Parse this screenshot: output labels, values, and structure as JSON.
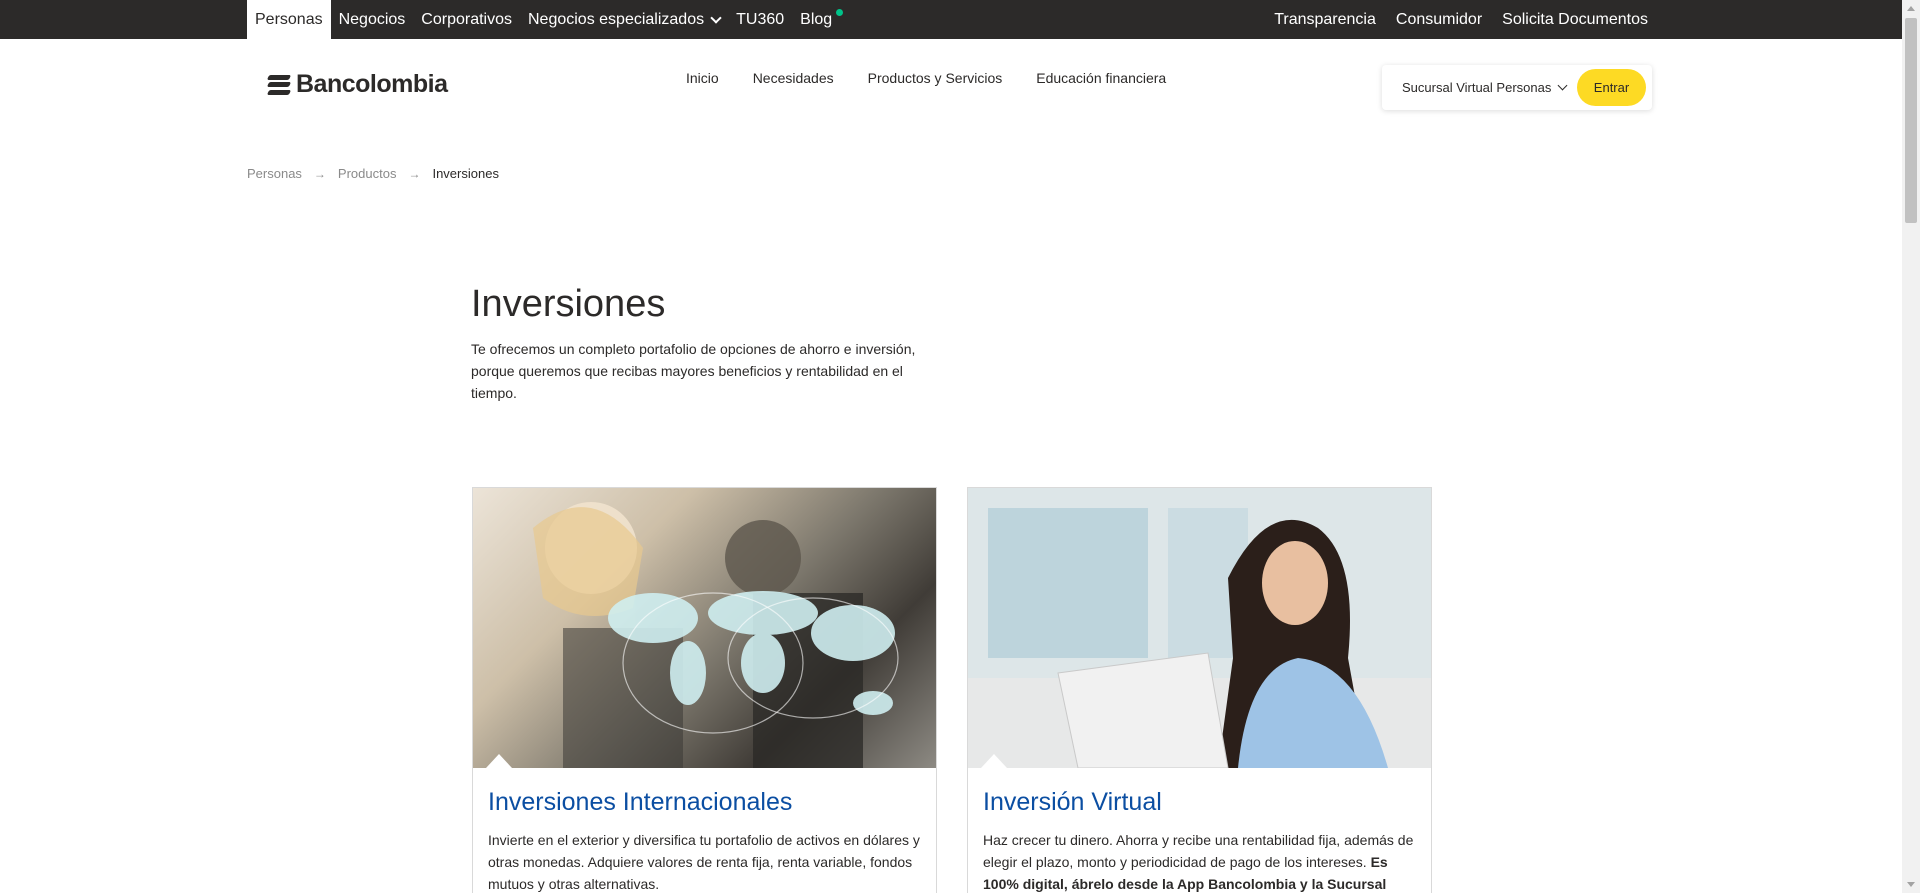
{
  "topbar": {
    "items": [
      "Personas",
      "Negocios",
      "Corporativos",
      "Negocios especializados",
      "TU360",
      "Blog"
    ],
    "right_items": [
      "Transparencia",
      "Consumidor",
      "Solicita Documentos"
    ]
  },
  "header": {
    "logo_text": "Bancolombia",
    "nav": [
      "Inicio",
      "Necesidades",
      "Productos y Servicios",
      "Educación financiera"
    ],
    "login_select": "Sucursal Virtual Personas",
    "login_button": "Entrar"
  },
  "breadcrumb": [
    "Personas",
    "Productos",
    "Inversiones"
  ],
  "hero": {
    "title": "Inversiones",
    "description": "Te ofrecemos un completo portafolio de opciones de ahorro e inversión, porque queremos que recibas mayores beneficios y rentabilidad en el tiempo."
  },
  "cards": [
    {
      "title": "Inversiones Internacionales",
      "text": "Invierte en el exterior y diversifica tu portafolio de activos en dólares y otras monedas. Adquiere valores de renta fija, renta variable, fondos mutuos  y otras alternativas."
    },
    {
      "title": "Inversión Virtual",
      "text": "Haz crecer tu dinero. Ahorra y recibe una rentabilidad fija, además de elegir el plazo, monto y periodicidad de pago de los intereses. ",
      "text_bold": "Es 100% digital, ábrelo desde la App Bancolombia y la Sucursal"
    }
  ],
  "colors": {
    "topbar_bg": "#2c2a29",
    "accent_yellow": "#fdda24",
    "card_title_blue": "#0b4ea2",
    "blog_dot": "#00c389"
  }
}
